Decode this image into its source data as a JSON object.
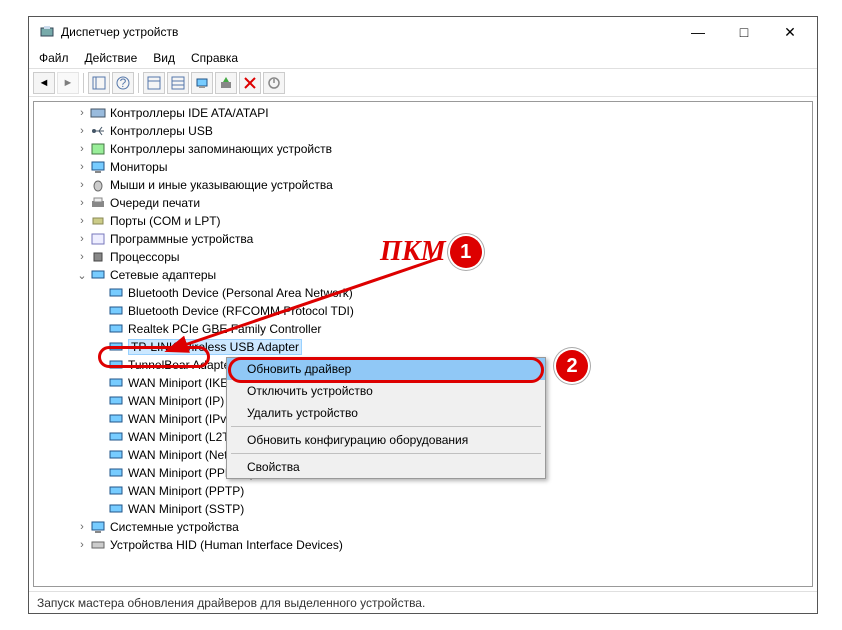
{
  "window": {
    "title": "Диспетчер устройств",
    "min": "—",
    "max": "□",
    "close": "✕"
  },
  "menu": {
    "file": "Файл",
    "action": "Действие",
    "view": "Вид",
    "help": "Справка"
  },
  "tree": {
    "ide": "Контроллеры IDE ATA/ATAPI",
    "usb": "Контроллеры USB",
    "storage": "Контроллеры запоминающих устройств",
    "monitors": "Мониторы",
    "mice": "Мыши и иные указывающие устройства",
    "printq": "Очереди печати",
    "ports": "Порты (COM и LPT)",
    "software": "Программные устройства",
    "cpu": "Процессоры",
    "netcat": "Сетевые адаптеры",
    "adapters": [
      "Bluetooth Device (Personal Area Network)",
      "Bluetooth Device (RFCOMM Protocol TDI)",
      "Realtek PCIe GBE Family Controller",
      "TP-LINK Wireless USB Adapter",
      "TunnelBear Adapter V9",
      "WAN Miniport (IKEv2)",
      "WAN Miniport (IP)",
      "WAN Miniport (IPv6)",
      "WAN Miniport (L2TP)",
      "WAN Miniport (Network Monitor)",
      "WAN Miniport (PPPOE)",
      "WAN Miniport (PPTP)",
      "WAN Miniport (SSTP)"
    ],
    "sysdev": "Системные устройства",
    "hid": "Устройства HID (Human Interface Devices)"
  },
  "ctx": {
    "upd": "Обновить драйвер",
    "dis": "Отключить устройство",
    "del": "Удалить устройство",
    "scan": "Обновить конфигурацию оборудования",
    "prop": "Свойства"
  },
  "status": "Запуск мастера обновления драйверов для выделенного устройства.",
  "annot": {
    "rmb": "ПКМ",
    "one": "1",
    "two": "2"
  }
}
